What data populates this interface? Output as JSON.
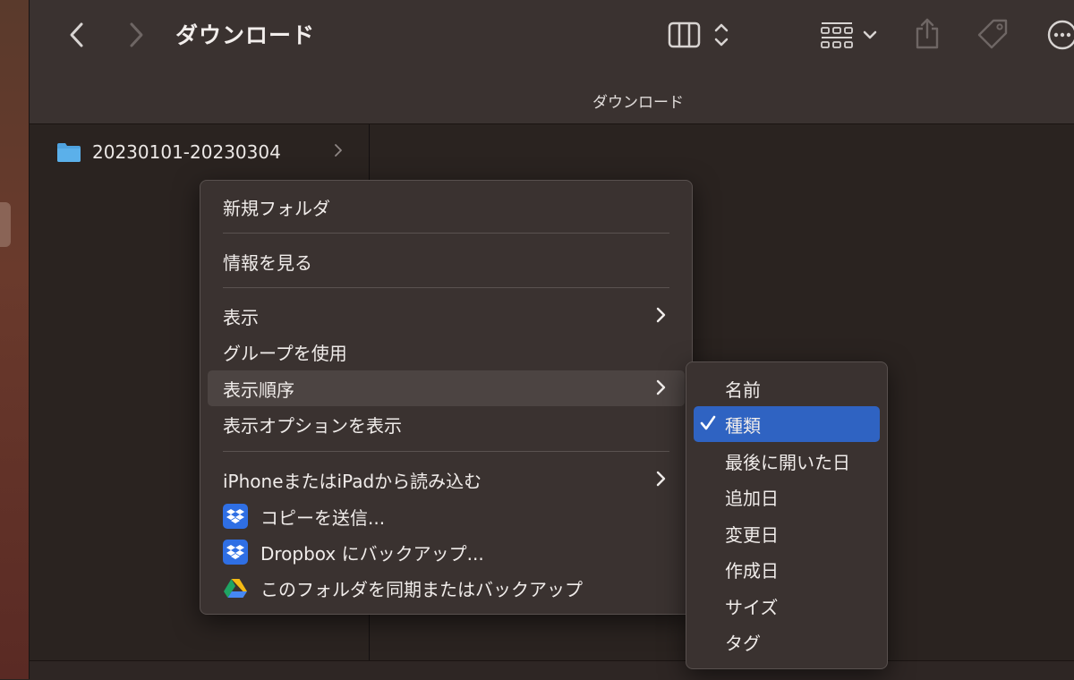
{
  "window": {
    "title": "ダウンロード",
    "path_title": "ダウンロード"
  },
  "toolbar": {
    "back_icon": "chevron-left-icon",
    "forward_icon": "chevron-right-icon",
    "view_icon": "column-view-icon",
    "group_icon": "grid-group-icon",
    "share_icon": "share-icon",
    "tag_icon": "tag-icon",
    "more_icon": "ellipsis-circle-icon"
  },
  "files": [
    {
      "name": "20230101-20230304",
      "icon": "folder-icon"
    }
  ],
  "context_menu": {
    "items": [
      {
        "label": "新規フォルダ"
      },
      {
        "label": "情報を見る"
      },
      {
        "label": "表示"
      },
      {
        "label": "グループを使用"
      },
      {
        "label": "表示順序"
      },
      {
        "label": "表示オプションを表示"
      },
      {
        "label": "iPhoneまたはiPadから読み込む"
      },
      {
        "label": "コピーを送信..."
      },
      {
        "label": "Dropbox にバックアップ..."
      },
      {
        "label": "このフォルダを同期またはバックアップ"
      }
    ]
  },
  "sort_submenu": {
    "items": [
      {
        "label": "名前",
        "checked": false
      },
      {
        "label": "種類",
        "checked": true
      },
      {
        "label": "最後に開いた日",
        "checked": false
      },
      {
        "label": "追加日",
        "checked": false
      },
      {
        "label": "変更日",
        "checked": false
      },
      {
        "label": "作成日",
        "checked": false
      },
      {
        "label": "サイズ",
        "checked": false
      },
      {
        "label": "タグ",
        "checked": false
      }
    ]
  },
  "colors": {
    "highlight": "#2f63c2",
    "dropbox": "#2f6fe4",
    "folder": "#4fa3e0"
  }
}
